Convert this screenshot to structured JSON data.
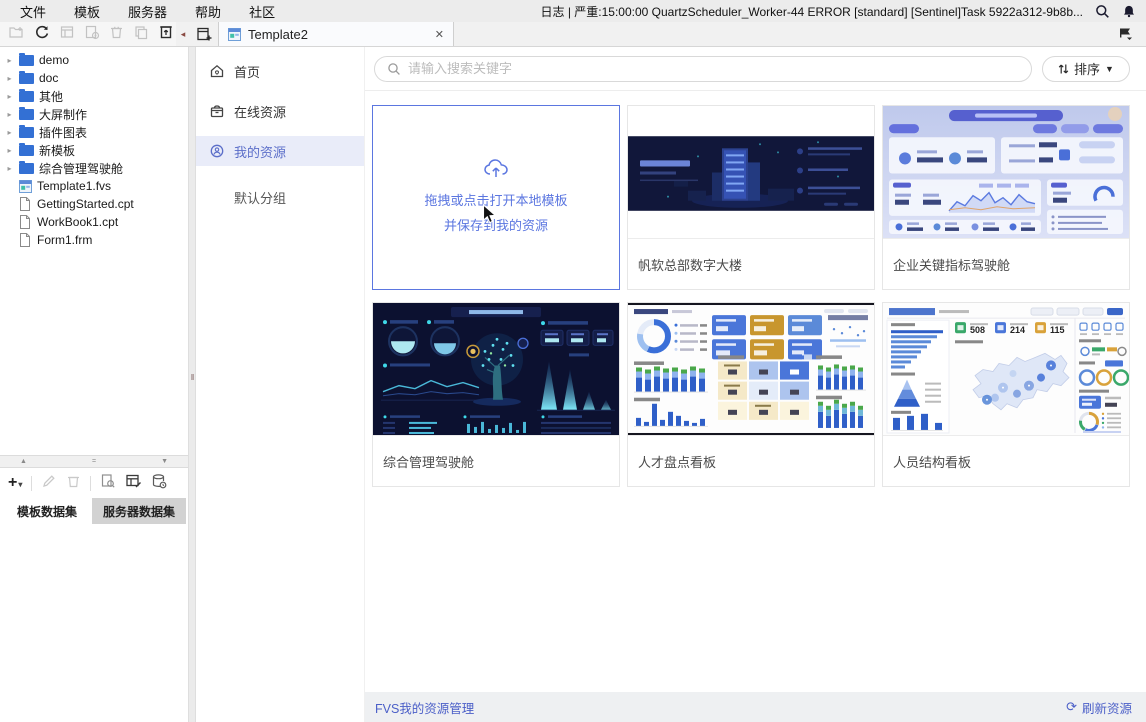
{
  "icons": {
    "close": "✕",
    "caret_down": "▾",
    "sort_caret": "▼",
    "expand": "▸",
    "collapse_left": "◂",
    "splitter_up": "▲",
    "splitter_eq": "=",
    "splitter_down": "▼",
    "v_handle": "‖",
    "refresh": "⟳",
    "plus": "+"
  },
  "menubar": {
    "items": [
      "文件",
      "模板",
      "服务器",
      "帮助",
      "社区"
    ],
    "status_text": "日志 | 严重:15:00:00 QuartzScheduler_Worker-44 ERROR [standard] [Sentinel]Task 5922a312-9b8b..."
  },
  "tabbar": {
    "active_tab": "Template2"
  },
  "file_tree": {
    "folders": [
      "demo",
      "doc",
      "其他",
      "大屏制作",
      "插件图表",
      "新模板",
      "综合管理驾驶舱"
    ],
    "files": [
      "Template1.fvs",
      "GettingStarted.cpt",
      "WorkBook1.cpt",
      "Form1.frm"
    ]
  },
  "dataset_panel": {
    "tabs": [
      "模板数据集",
      "服务器数据集"
    ]
  },
  "resource_nav": {
    "items": [
      "首页",
      "在线资源",
      "我的资源"
    ],
    "group_label": "默认分组"
  },
  "search": {
    "placeholder": "请输入搜索关键字"
  },
  "sort": {
    "label": "排序"
  },
  "upload_card": {
    "line1": "拖拽或点击打开本地模板",
    "line2": "并保存到我的资源"
  },
  "cards": [
    {
      "title": "帆软总部数字大楼"
    },
    {
      "title": "企业关键指标驾驶舱"
    },
    {
      "title": "综合管理驾驶舱"
    },
    {
      "title": "人才盘点看板"
    },
    {
      "title": "人员结构看板"
    }
  ],
  "thumbs": {
    "personnel_kpis": [
      "508",
      "214",
      "115"
    ]
  },
  "footer": {
    "title": "FVS我的资源管理",
    "refresh_label": "刷新资源"
  },
  "colors": {
    "accent_blue": "#4e6ef2",
    "nav_selected_bg": "#e9ecf9",
    "folder_blue": "#3370d4",
    "footer_link": "#4b5fc8",
    "dark_thumb_bg": "#0c1130"
  }
}
